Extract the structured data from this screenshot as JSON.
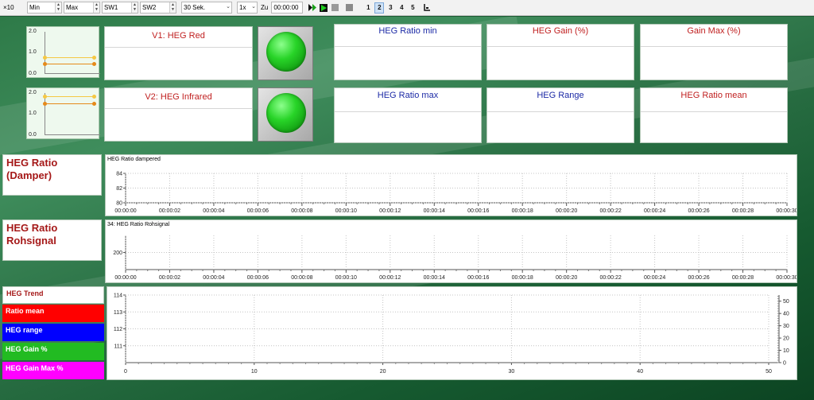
{
  "toolbar": {
    "ctl0": "×10",
    "min_label": "Min",
    "max_label": "Max",
    "sw1": "SW1",
    "sw2": "SW2",
    "duration": "30 Sek.",
    "speed": "1x",
    "zu_label": "Zu",
    "time_value": "00:00:00",
    "pages": [
      "1",
      "2",
      "3",
      "4",
      "5"
    ],
    "active_page": "2"
  },
  "channels": {
    "v1_title": "V1: HEG Red",
    "v2_title": "V2: HEG Infrared",
    "mini_ticks": [
      "2.0",
      "1.0",
      "0.0"
    ]
  },
  "stats": {
    "ratio_min": "HEG Ratio min",
    "gain": "HEG Gain (%)",
    "gain_max": "Gain Max (%)",
    "ratio_max": "HEG Ratio max",
    "range": "HEG Range",
    "ratio_mean": "HEG Ratio mean"
  },
  "rows": {
    "damper_label": "HEG Ratio (Damper)",
    "raw_label": "HEG Ratio Rohsignal"
  },
  "trend": {
    "title": "HEG Trend",
    "items": [
      {
        "label": "Ratio mean",
        "color": "#ff0000"
      },
      {
        "label": "HEG range",
        "color": "#0000ff"
      },
      {
        "label": "HEG Gain %",
        "color": "#22bb22"
      },
      {
        "label": "HEG Gain Max %",
        "color": "#ff00ff"
      }
    ]
  },
  "colors": {
    "mini_line_top": "#f5c843",
    "mini_line_bottom": "#e58a1a"
  },
  "chart_data": [
    {
      "type": "line",
      "title": "HEG Ratio dampered",
      "y_ticks": [
        "84",
        "82",
        "80"
      ],
      "ylim": [
        80,
        84
      ],
      "x_ticks": [
        "00:00:00",
        "00:00:02",
        "00:00:04",
        "00:00:06",
        "00:00:08",
        "00:00:10",
        "00:00:12",
        "00:00:14",
        "00:00:16",
        "00:00:18",
        "00:00:20",
        "00:00:22",
        "00:00:24",
        "00:00:26",
        "00:00:28",
        "00:00:30"
      ],
      "grid": true,
      "series": []
    },
    {
      "type": "line",
      "title": "34: HEG Ratio Rohsignal",
      "y_ticks": [
        "200"
      ],
      "x_ticks": [
        "00:00:00",
        "00:00:02",
        "00:00:04",
        "00:00:06",
        "00:00:08",
        "00:00:10",
        "00:00:12",
        "00:00:14",
        "00:00:16",
        "00:00:18",
        "00:00:20",
        "00:00:22",
        "00:00:24",
        "00:00:26",
        "00:00:28",
        "00:00:30"
      ],
      "grid": true,
      "series": []
    },
    {
      "type": "line",
      "title": "",
      "y_ticks": [
        "114",
        "113",
        "112",
        "111"
      ],
      "ylim": [
        110,
        114
      ],
      "y2_ticks": [
        "50",
        "40",
        "30",
        "20",
        "10",
        "0"
      ],
      "y2lim": [
        0,
        55
      ],
      "x_ticks": [
        "0",
        "10",
        "20",
        "30",
        "40",
        "50"
      ],
      "xlim": [
        0,
        50
      ],
      "grid": true,
      "series": []
    }
  ]
}
